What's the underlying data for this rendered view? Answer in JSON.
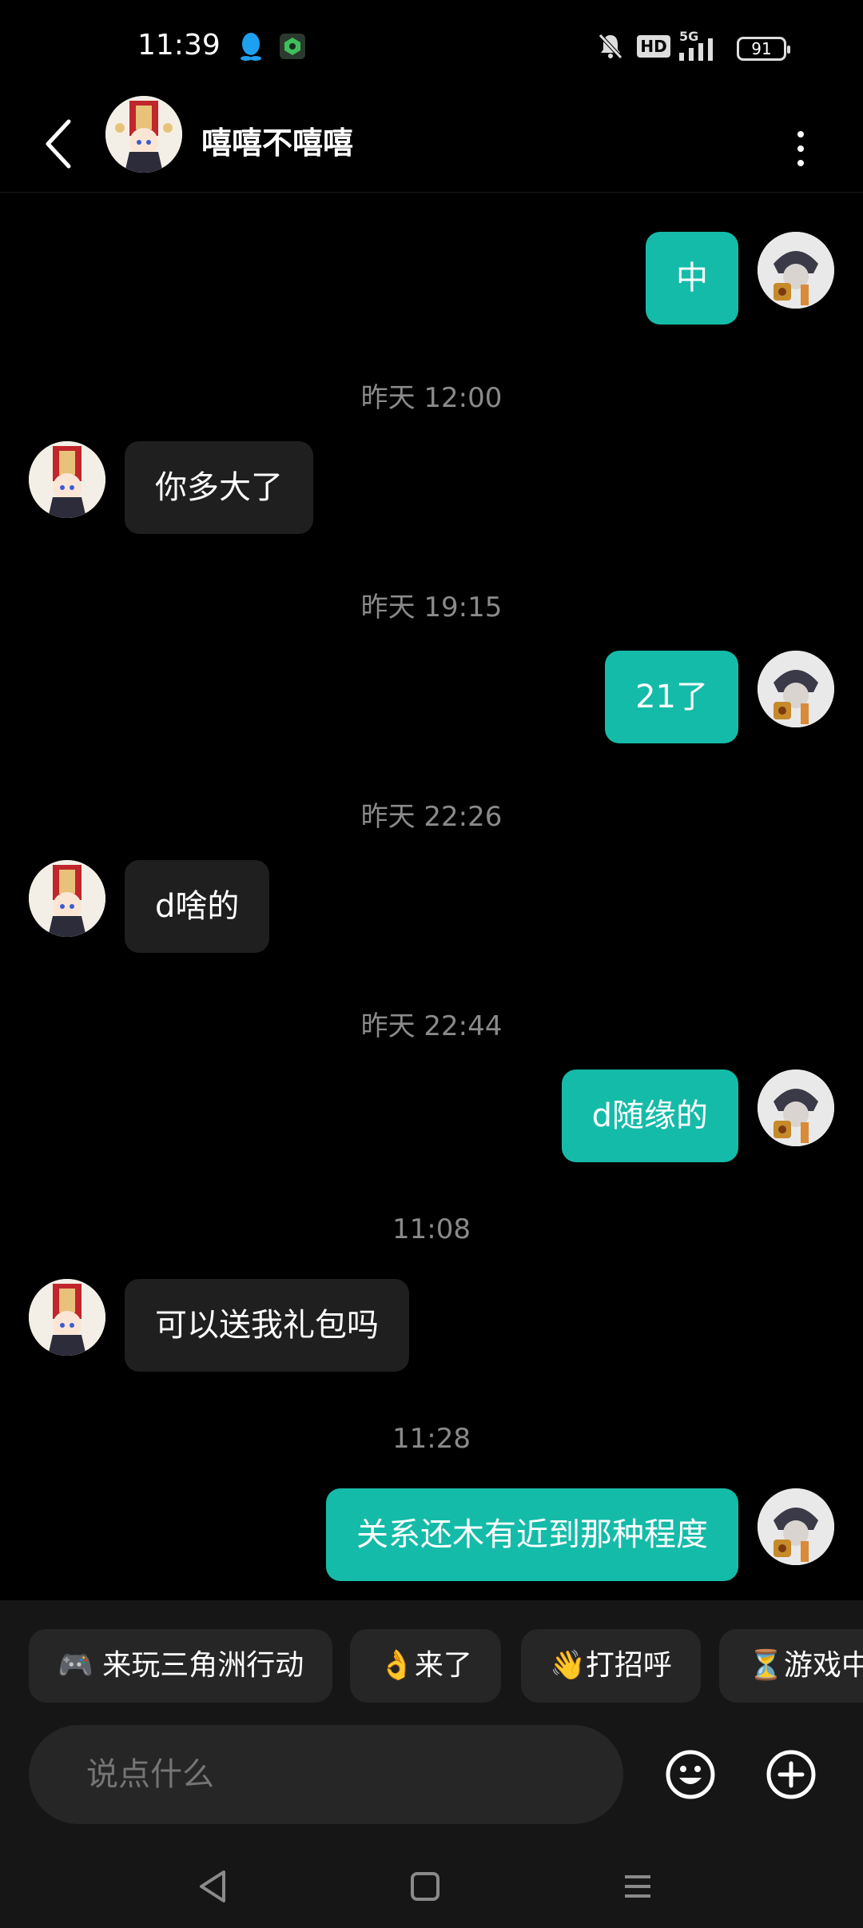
{
  "status_bar": {
    "time": "11:39",
    "icons": [
      "qq-icon",
      "shield-app-icon",
      "mute-bell-icon",
      "hd-icon",
      "5g-signal-icon"
    ],
    "hd_label": "HD",
    "network_label": "5G",
    "battery": "91"
  },
  "header": {
    "contact_name": "嘻嘻不嘻嘻",
    "back_icon": "chevron-left-icon",
    "more_icon": "vertical-dots-icon"
  },
  "messages": [
    {
      "type": "out",
      "text": "中"
    },
    {
      "type": "time",
      "text": "昨天  12:00"
    },
    {
      "type": "in",
      "text": "你多大了"
    },
    {
      "type": "time",
      "text": "昨天  19:15"
    },
    {
      "type": "out",
      "text": "21了"
    },
    {
      "type": "time",
      "text": "昨天  22:26"
    },
    {
      "type": "in",
      "text": "d啥的"
    },
    {
      "type": "time",
      "text": "昨天  22:44"
    },
    {
      "type": "out",
      "text": "d随缘的"
    },
    {
      "type": "time",
      "text": "11:08"
    },
    {
      "type": "in",
      "text": "可以送我礼包吗"
    },
    {
      "type": "time",
      "text": "11:28"
    },
    {
      "type": "out",
      "text": "关系还木有近到那种程度"
    }
  ],
  "quick_replies": [
    "🎮 来玩三角洲行动",
    "👌来了",
    "👋打招呼",
    "⏳游戏中"
  ],
  "composer": {
    "placeholder": "说点什么",
    "emoji_icon": "smiley-icon",
    "add_icon": "plus-circle-icon"
  },
  "nav_bar": [
    "back-triangle-icon",
    "home-square-icon",
    "menu-lines-icon"
  ],
  "colors": {
    "background": "#000000",
    "outgoing_bubble": "#15bba9",
    "incoming_bubble": "#1f1f1f",
    "timestamp": "#8a8a8a"
  }
}
